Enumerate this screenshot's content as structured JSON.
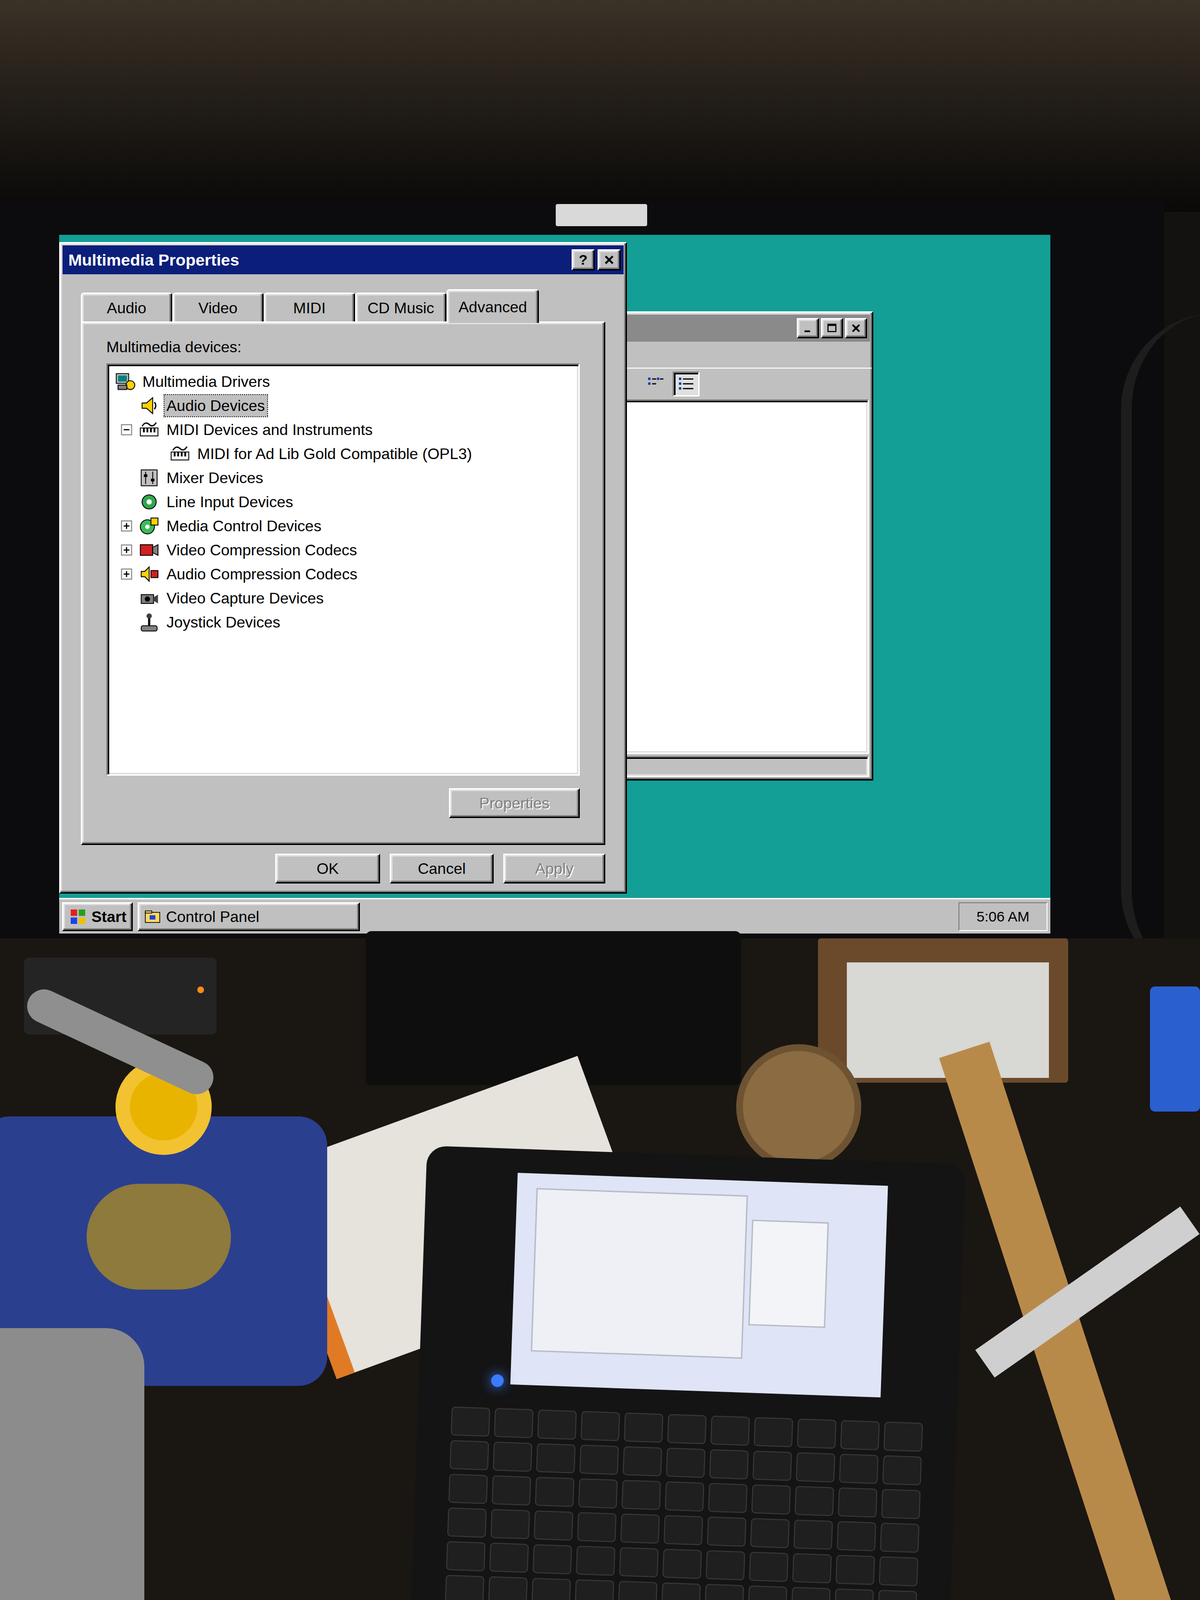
{
  "screen": {
    "dialog": {
      "title": "Multimedia Properties",
      "help_button": "?",
      "tabs": [
        {
          "label": "Audio",
          "selected": false
        },
        {
          "label": "Video",
          "selected": false
        },
        {
          "label": "MIDI",
          "selected": false
        },
        {
          "label": "CD Music",
          "selected": false
        },
        {
          "label": "Advanced",
          "selected": true
        }
      ],
      "list_label": "Multimedia devices:",
      "tree": [
        {
          "label": "Multimedia Drivers",
          "depth": 0,
          "expandable": false,
          "expanded": false,
          "selected": false
        },
        {
          "label": "Audio Devices",
          "depth": 1,
          "expandable": false,
          "expanded": false,
          "selected": true
        },
        {
          "label": "MIDI Devices and Instruments",
          "depth": 1,
          "expandable": true,
          "expanded": true,
          "selected": false
        },
        {
          "label": "MIDI for Ad Lib Gold Compatible (OPL3)",
          "depth": 2,
          "expandable": false,
          "expanded": false,
          "selected": false
        },
        {
          "label": "Mixer Devices",
          "depth": 1,
          "expandable": false,
          "expanded": false,
          "selected": false
        },
        {
          "label": "Line Input Devices",
          "depth": 1,
          "expandable": false,
          "expanded": false,
          "selected": false
        },
        {
          "label": "Media Control Devices",
          "depth": 1,
          "expandable": true,
          "expanded": false,
          "selected": false
        },
        {
          "label": "Video Compression Codecs",
          "depth": 1,
          "expandable": true,
          "expanded": false,
          "selected": false
        },
        {
          "label": "Audio Compression Codecs",
          "depth": 1,
          "expandable": true,
          "expanded": false,
          "selected": false
        },
        {
          "label": "Video Capture Devices",
          "depth": 1,
          "expandable": false,
          "expanded": false,
          "selected": false
        },
        {
          "label": "Joystick Devices",
          "depth": 1,
          "expandable": false,
          "expanded": false,
          "selected": false
        }
      ],
      "properties_button": {
        "label": "Properties",
        "disabled": true
      },
      "buttons": [
        {
          "label": "OK",
          "disabled": false
        },
        {
          "label": "Cancel",
          "disabled": false
        },
        {
          "label": "Apply",
          "disabled": true
        }
      ]
    },
    "taskbar": {
      "start": "Start",
      "tasks": [
        {
          "label": "Control Panel",
          "selected": false
        }
      ],
      "clock": "5:06 AM"
    }
  }
}
